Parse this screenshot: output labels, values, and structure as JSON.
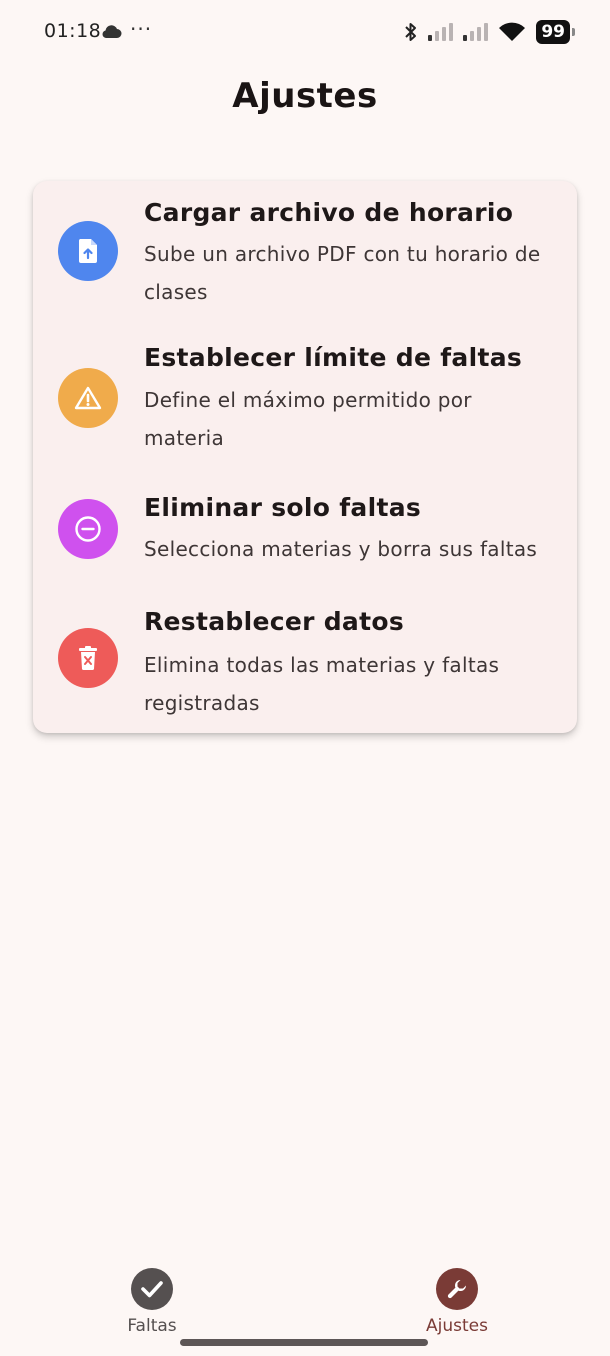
{
  "status_bar": {
    "time": "01:18",
    "dots": "···",
    "battery": "99",
    "icons": [
      "cloud-icon",
      "bluetooth-icon",
      "signal-icon",
      "signal-icon",
      "wifi-icon",
      "battery-icon"
    ]
  },
  "header": {
    "title": "Ajustes"
  },
  "settings": {
    "items": [
      {
        "title": "Cargar archivo de horario",
        "description": "Sube un archivo PDF con tu horario de clases",
        "icon": "file-upload-icon",
        "color": "#4f86ee"
      },
      {
        "title": "Establecer límite de faltas",
        "description": "Define el máximo permitido por materia",
        "icon": "warning-icon",
        "color": "#f0ab4b"
      },
      {
        "title": "Eliminar solo faltas",
        "description": "Selecciona materias y borra sus faltas",
        "icon": "minus-circle-icon",
        "color": "#cf51ee"
      },
      {
        "title": "Restablecer datos",
        "description": "Elimina todas las materias y faltas registradas",
        "icon": "delete-icon",
        "color": "#ee5b59"
      }
    ]
  },
  "bottom_nav": {
    "items": [
      {
        "label": "Faltas",
        "icon": "check-circle-icon",
        "color": "#555050",
        "active": false
      },
      {
        "label": "Ajustes",
        "icon": "wrench-icon",
        "color": "#7a3b36",
        "active": true
      }
    ]
  }
}
